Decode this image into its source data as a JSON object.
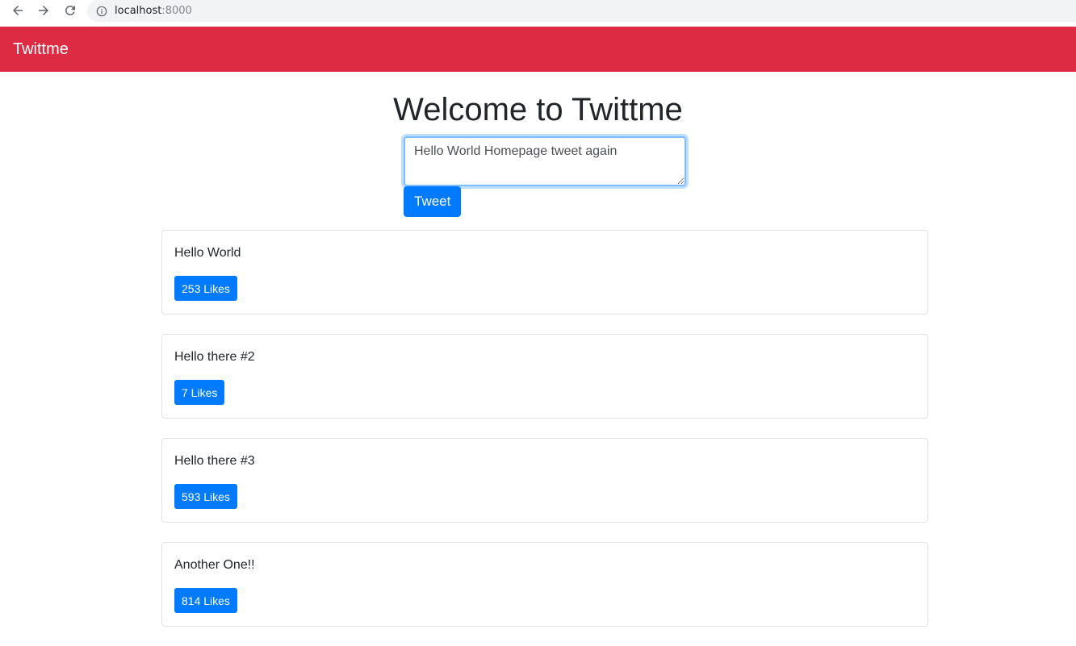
{
  "browser": {
    "url_host": "localhost",
    "url_port": ":8000"
  },
  "navbar": {
    "brand": "Twittme",
    "color": "#dc2b42"
  },
  "main": {
    "title": "Welcome to Twittme",
    "tweet_input_value": "Hello World Homepage tweet again",
    "tweet_button": "Tweet"
  },
  "tweets": [
    {
      "text": "Hello World",
      "likes_label": "253 Likes"
    },
    {
      "text": "Hello there #2",
      "likes_label": "7 Likes"
    },
    {
      "text": "Hello there #3",
      "likes_label": "593 Likes"
    },
    {
      "text": "Another One!!",
      "likes_label": "814 Likes"
    }
  ],
  "colors": {
    "primary": "#007bff"
  }
}
